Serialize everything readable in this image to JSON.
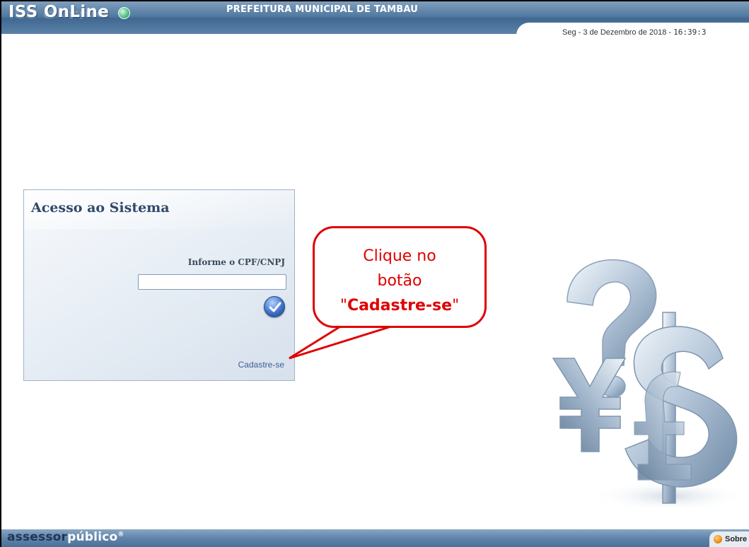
{
  "header": {
    "app_name": "ISS OnLine",
    "municipality": "PREFEITURA MUNICIPAL DE TAMBAU",
    "date": "Seg  -  3 de Dezembro de 2018  -",
    "time": "16:39:3"
  },
  "login": {
    "title": "Acesso ao Sistema",
    "cpf_label": "Informe o CPF/CNPJ",
    "cpf_value": "",
    "register_link": "Cadastre-se"
  },
  "callout": {
    "line1": "Clique no",
    "line2": "botão",
    "quote_open": "\"",
    "line3": "Cadastre-se",
    "quote_close": "\""
  },
  "footer": {
    "brand_dark": "assessor",
    "brand_light": "público",
    "brand_mark": "®",
    "about_label": "Sobre"
  },
  "colors": {
    "header": "#4f779e",
    "callout_red": "#e00000",
    "link": "#3a5f9a"
  }
}
